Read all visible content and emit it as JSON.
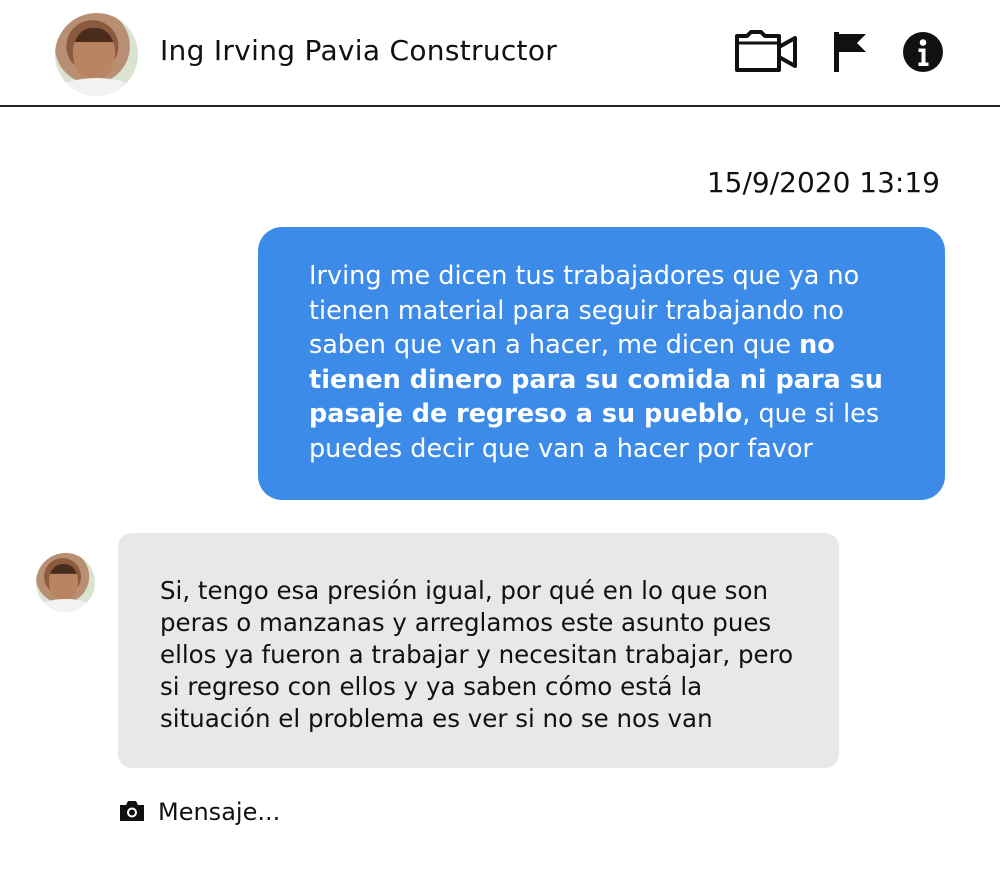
{
  "header": {
    "contact_name": "Ing Irving Pavia Constructor",
    "icons": [
      "video-call-icon",
      "flag-icon",
      "info-icon"
    ]
  },
  "conversation": {
    "timestamp": "15/9/2020 13:19",
    "messages": [
      {
        "direction": "outgoing",
        "text_before": "Irving me dicen tus trabajadores que ya no tienen material para seguir trabajando no saben que van a hacer, me dicen que ",
        "text_bold": "no tienen dinero para su comida ni para su pasaje de regreso a su pueblo",
        "text_after": ", que si les puedes decir que van a hacer por favor"
      },
      {
        "direction": "incoming",
        "text": "Si, tengo esa presión igual, por qué en lo que son peras o manzanas y arreglamos este asunto pues ellos ya fueron a trabajar y necesitan trabajar, pero si regreso con ellos y ya saben cómo está la situación el problema es ver si no se nos van"
      }
    ]
  },
  "composer": {
    "placeholder": "Mensaje..."
  },
  "colors": {
    "outgoing_bubble": "#3d8be9",
    "incoming_bubble": "#e8e8e8",
    "text": "#111111"
  }
}
